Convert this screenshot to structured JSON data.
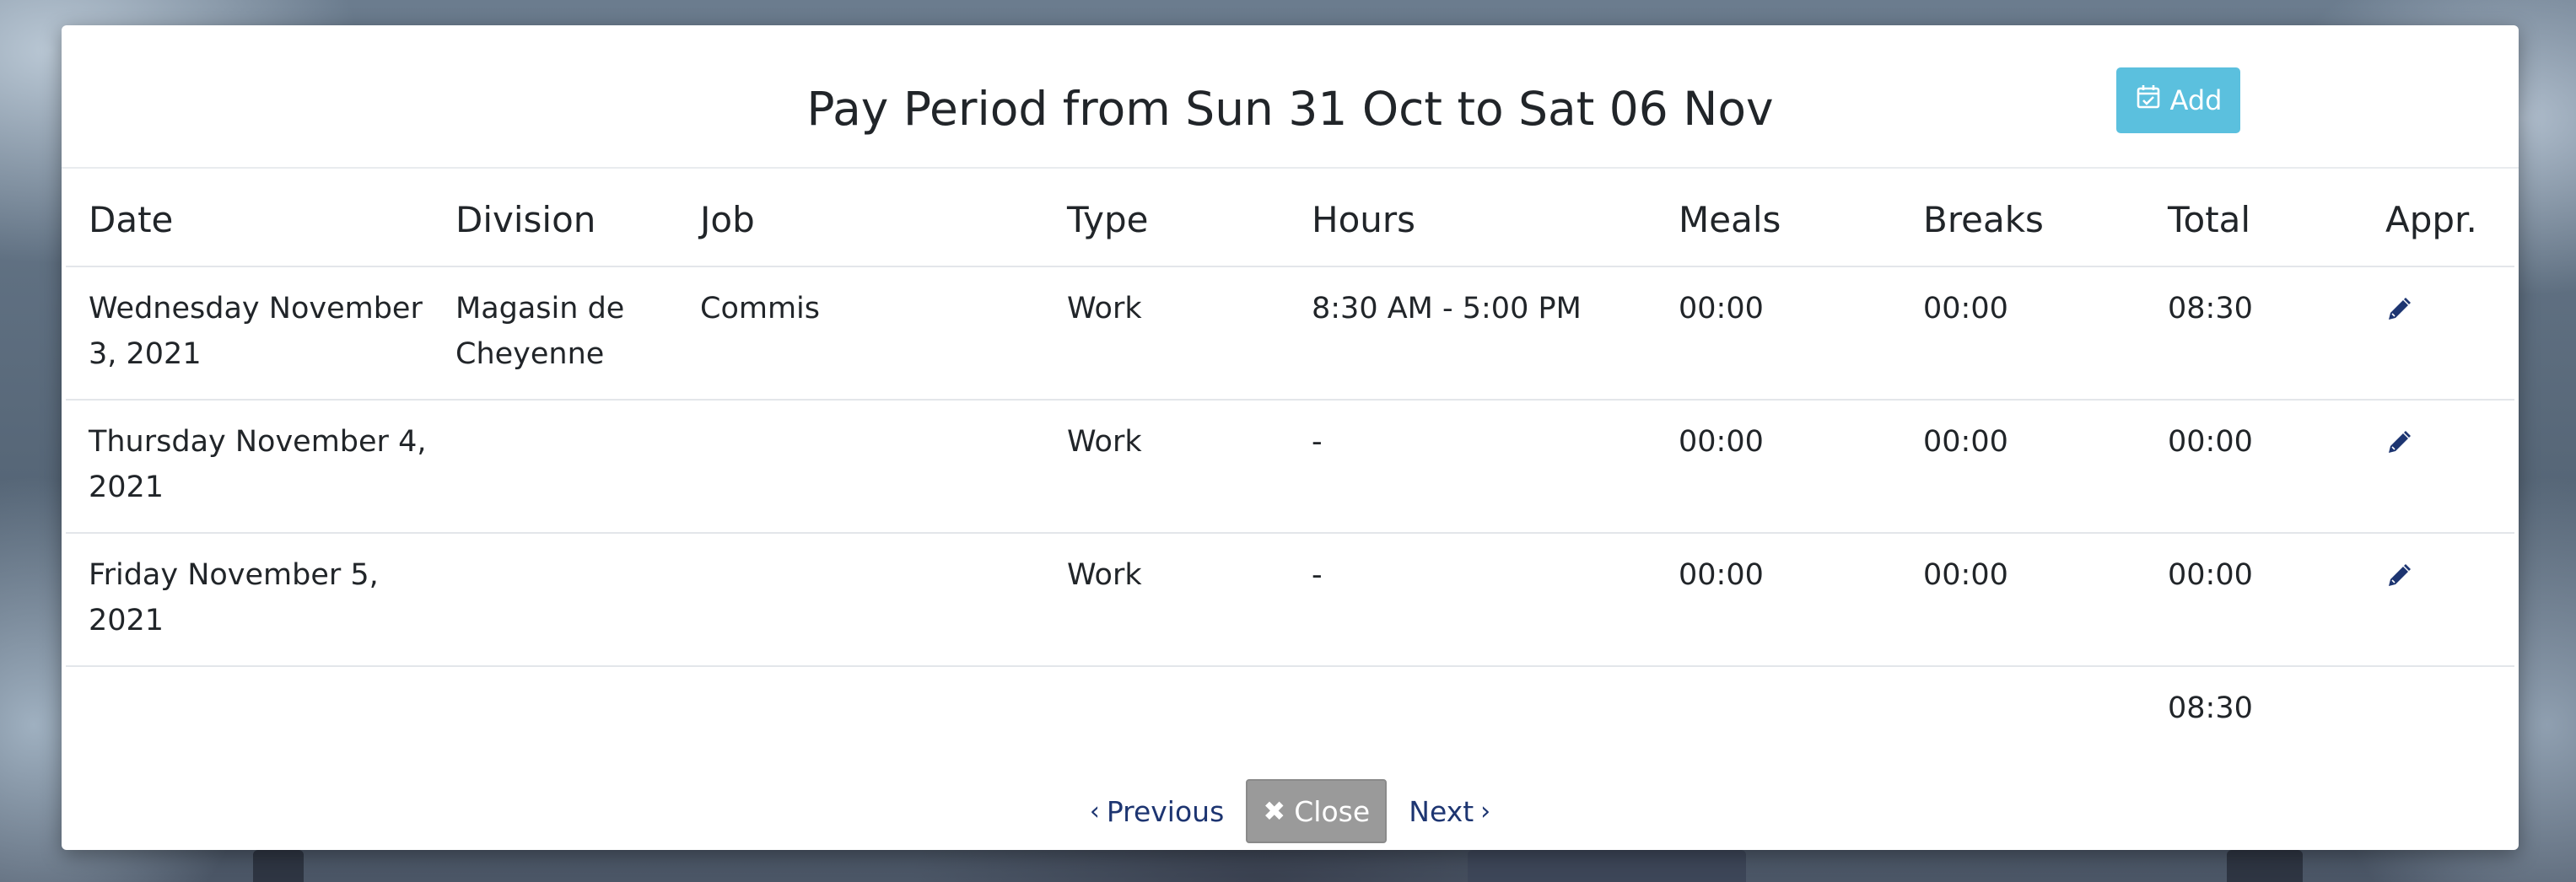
{
  "modal": {
    "title": "Pay Period from Sun 31 Oct to Sat 06 Nov",
    "add_label": "Add",
    "add_icon": "calendar-check-icon"
  },
  "table": {
    "headers": [
      "Date",
      "Division",
      "Job",
      "Type",
      "Hours",
      "Meals",
      "Breaks",
      "Total",
      "Appr."
    ],
    "rows": [
      {
        "date": "Wednesday November 3, 2021",
        "division": "Magasin de Cheyenne",
        "job": "Commis",
        "type": "Work",
        "hours": "8:30 AM - 5:00 PM",
        "meals": "00:00",
        "breaks": "00:00",
        "total": "08:30",
        "appr_icon": "pencil-icon"
      },
      {
        "date": "Thursday November 4, 2021",
        "division": "",
        "job": "",
        "type": "Work",
        "hours": "-",
        "meals": "00:00",
        "breaks": "00:00",
        "total": "00:00",
        "appr_icon": "pencil-icon"
      },
      {
        "date": "Friday November 5, 2021",
        "division": "",
        "job": "",
        "type": "Work",
        "hours": "-",
        "meals": "00:00",
        "breaks": "00:00",
        "total": "00:00",
        "appr_icon": "pencil-icon"
      }
    ],
    "grand_total": "08:30"
  },
  "footer": {
    "previous_label": "Previous",
    "close_label": "Close",
    "next_label": "Next"
  },
  "colors": {
    "add_button": "#5bc0de",
    "close_button": "#9a9a9a",
    "link": "#1d3571",
    "edit_icon": "#1d3571"
  }
}
